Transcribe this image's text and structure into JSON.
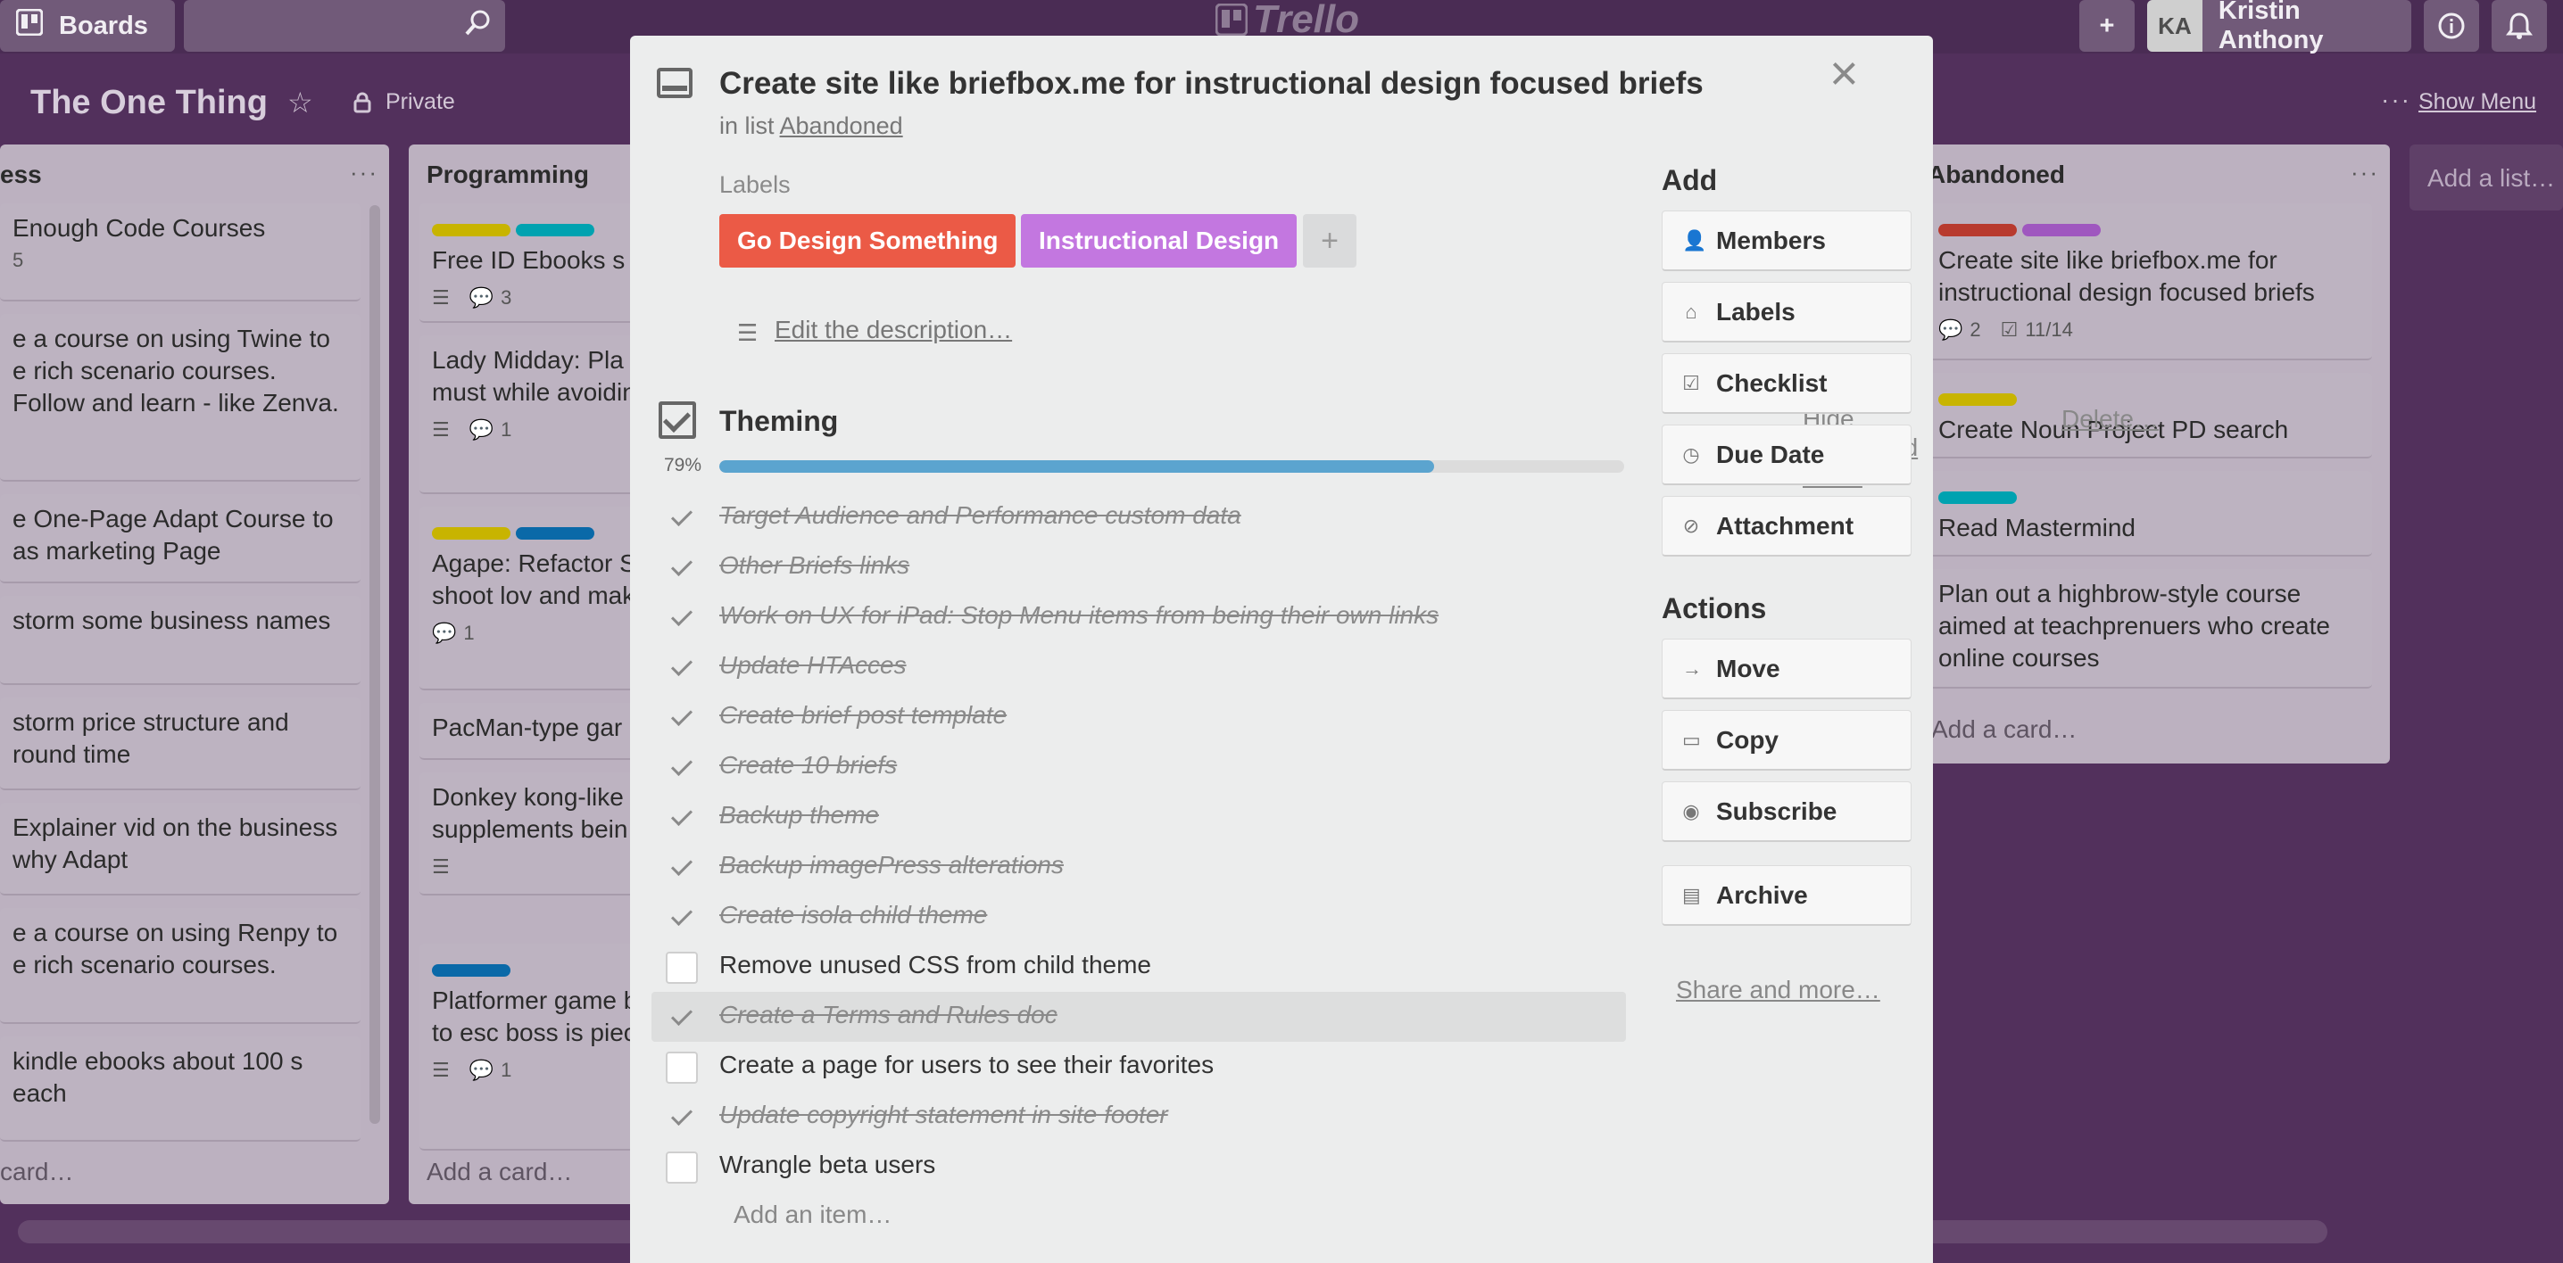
{
  "header": {
    "boards_label": "Boards",
    "logo_text": "Trello",
    "user_initials": "KA",
    "user_name": "Kristin Anthony"
  },
  "board": {
    "title": "The One Thing",
    "visibility": "Private",
    "show_menu": "Show Menu",
    "add_list": "Add a list…"
  },
  "lists": {
    "left": {
      "title": "ess",
      "cards": [
        {
          "text": "Enough Code Courses",
          "sub": "5"
        },
        {
          "text": "e a course on using Twine to e rich scenario courses. Follow and learn - like Zenva."
        },
        {
          "text": "e One-Page Adapt Course to as marketing Page"
        },
        {
          "text": "storm some business names"
        },
        {
          "text": "storm price structure and round time"
        },
        {
          "text": "Explainer vid on the business why Adapt"
        },
        {
          "text": "e a course on using Renpy to e rich scenario courses."
        },
        {
          "text": "kindle ebooks about 100 s each"
        }
      ],
      "add_card": "card…"
    },
    "programming": {
      "title": "Programming",
      "cards": [
        {
          "text": "Free ID Ebooks s",
          "comments": "3"
        },
        {
          "text": "Lady Midday: Pla worker who must while avoiding lad",
          "comments": "1"
        },
        {
          "text": "Agape: Refactor S game to shoot lov and make them m",
          "comments": "1"
        },
        {
          "text": "PacMan-type gar"
        },
        {
          "text": "Donkey kong-like supplements bein"
        },
        {
          "text": "Platformer game bread tries to esc boss is piece of t vision",
          "comments": "1"
        }
      ],
      "add_card": "Add a card…"
    },
    "abandoned": {
      "title": "Abandoned",
      "cards": [
        {
          "text": "Create site like briefbox.me for instructional design focused briefs",
          "comments": "2",
          "checklist": "11/14"
        },
        {
          "text": "Create Noun Project PD search"
        },
        {
          "text": "Read Mastermind"
        },
        {
          "text": "Plan out a highbrow-style course aimed at teachprenuers who create online courses"
        }
      ],
      "add_card": "Add a card…"
    }
  },
  "modal": {
    "title": "Create site like briefbox.me for instructional design focused briefs",
    "in_list_prefix": "in list",
    "in_list_name": "Abandoned",
    "labels_heading": "Labels",
    "labels": [
      {
        "name": "Go Design Something",
        "color": "#eb5a46"
      },
      {
        "name": "Instructional Design",
        "color": "#c377e0"
      }
    ],
    "description_link": "Edit the description…",
    "checklist": {
      "title": "Theming",
      "hide_completed": "Hide completed items",
      "delete": "Delete…",
      "percent_label": "79%",
      "progress": 0.79,
      "items": [
        {
          "text": "Target Audience and Performance custom data",
          "done": true
        },
        {
          "text": "Other Briefs links",
          "done": true
        },
        {
          "text": "Work on UX for iPad: Stop Menu items from being their own links",
          "done": true
        },
        {
          "text": "Update HTAcces",
          "done": true
        },
        {
          "text": "Create brief post template",
          "done": true
        },
        {
          "text": "Create 10 briefs",
          "done": true
        },
        {
          "text": "Backup theme",
          "done": true
        },
        {
          "text": "Backup imagePress alterations",
          "done": true
        },
        {
          "text": "Create isola child theme",
          "done": true
        },
        {
          "text": "Remove unused CSS from child theme",
          "done": false
        },
        {
          "text": "Create a Terms and Rules doc",
          "done": true
        },
        {
          "text": "Create a page for users to see their favorites",
          "done": false
        },
        {
          "text": "Update copyright statement in site footer",
          "done": true
        },
        {
          "text": "Wrangle beta users",
          "done": false
        }
      ],
      "add_item": "Add an item…"
    },
    "sidebar": {
      "add_heading": "Add",
      "add_buttons": [
        "Members",
        "Labels",
        "Checklist",
        "Due Date",
        "Attachment"
      ],
      "actions_heading": "Actions",
      "action_buttons": [
        "Move",
        "Copy",
        "Subscribe",
        "Archive"
      ],
      "share": "Share and more…"
    }
  },
  "colors": {
    "background": "#52305c",
    "progress": "#5ba4cf",
    "label_yellow": "#c8b400",
    "label_teal": "#00a2b0",
    "label_blue": "#0a69a8",
    "label_red": "#b83a2e",
    "label_purple": "#9f57bf"
  }
}
